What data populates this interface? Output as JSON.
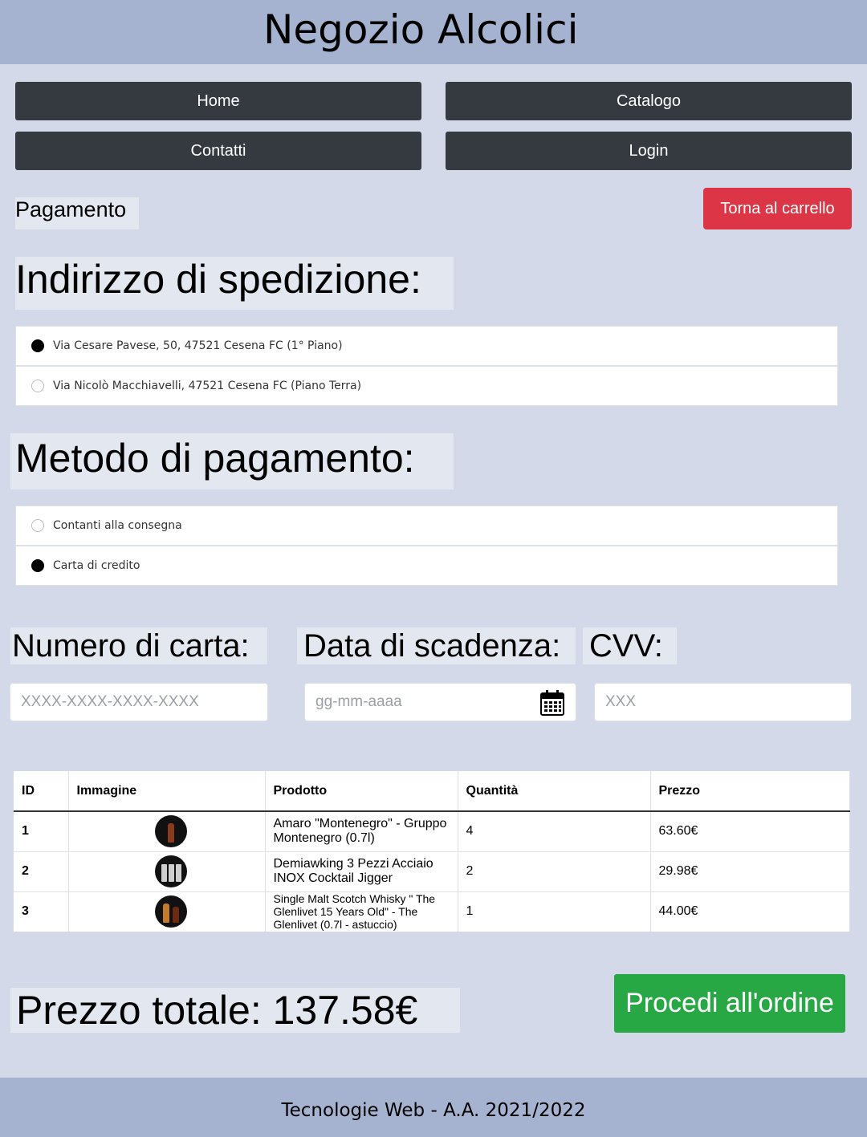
{
  "header": {
    "title": "Negozio Alcolici"
  },
  "nav": {
    "home": "Home",
    "catalogo": "Catalogo",
    "contatti": "Contatti",
    "login": "Login"
  },
  "page": {
    "breadcrumb": "Pagamento",
    "back_button": "Torna al carrello"
  },
  "shipping": {
    "heading": "Indirizzo di spedizione:",
    "options": [
      {
        "label": "Via Cesare Pavese, 50, 47521 Cesena FC (1° Piano)",
        "selected": true
      },
      {
        "label": "Via Nicolò Macchiavelli, 47521 Cesena FC (Piano Terra)",
        "selected": false
      }
    ]
  },
  "payment": {
    "heading": "Metodo di pagamento:",
    "options": [
      {
        "label": "Contanti alla consegna",
        "selected": false
      },
      {
        "label": "Carta di credito",
        "selected": true
      }
    ]
  },
  "card": {
    "number_label": "Numero di carta:",
    "number_placeholder": "XXXX-XXXX-XXXX-XXXX",
    "expiry_label": "Data di scadenza:",
    "expiry_placeholder": "gg-mm-aaaa",
    "cvv_label": "CVV:",
    "cvv_placeholder": "XXX",
    "calendar_icon": "calendar-icon"
  },
  "table": {
    "headers": [
      "ID",
      "Immagine",
      "Prodotto",
      "Quantità",
      "Prezzo"
    ],
    "rows": [
      {
        "id": "1",
        "image": "bottle-image",
        "product": "Amaro \"Montenegro\" - Gruppo Montenegro (0.7l)",
        "quantity": "4",
        "price": "63.60€"
      },
      {
        "id": "2",
        "image": "jigger-set-image",
        "product": "Demiawking 3 Pezzi Acciaio INOX Cocktail Jigger",
        "quantity": "2",
        "price": "29.98€"
      },
      {
        "id": "3",
        "image": "whisky-bottle-image",
        "product": "Single Malt Scotch Whisky \" The Glenlivet 15 Years Old\" - The Glenlivet (0.7l - astuccio)",
        "quantity": "1",
        "price": "44.00€"
      }
    ]
  },
  "summary": {
    "total": "Prezzo totale: 137.58€",
    "order_button": "Procedi all'ordine"
  },
  "footer": {
    "text": "Tecnologie Web - A.A. 2021/2022"
  },
  "colors": {
    "background": "#d3d9e8",
    "header": "#a5b3d1",
    "nav_button": "#343a40",
    "red": "#dc3545",
    "green": "#28a745"
  }
}
